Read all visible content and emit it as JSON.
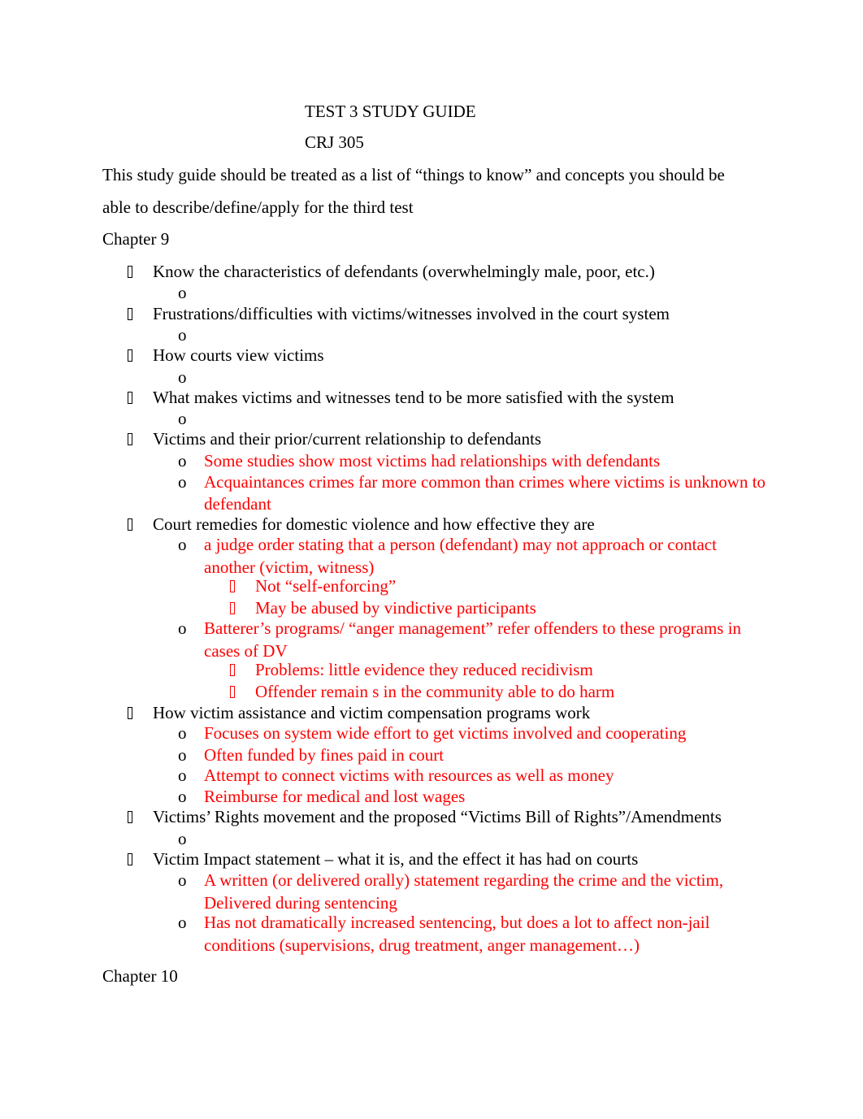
{
  "document": {
    "title": "TEST 3 STUDY GUIDE",
    "course": "CRJ 305",
    "intro_line1": "This study guide should be treated as a list of “things to know” and concepts you should be",
    "intro_line2": "able to describe/define/apply for the third test",
    "chapter9": "Chapter 9",
    "chapter10": "Chapter 10",
    "bullet_l2": "o",
    "items": [
      {
        "text": "Know the characteristics of defendants (overwhelmingly male, poor, etc.)"
      },
      {
        "text": "Frustrations/difficulties with victims/witnesses involved in the court system"
      },
      {
        "text": "How courts view victims"
      },
      {
        "text": "What makes victims and witnesses tend to be more satisfied with the system"
      },
      {
        "text": "Victims and their prior/current relationship to defendants",
        "subs": [
          "Some studies show most victims had relationships with defendants",
          "Acquaintances crimes far more common than crimes where victims is unknown to",
          "defendant"
        ]
      },
      {
        "text": "Court remedies for domestic violence and how effective they are",
        "subs": [
          "a judge order stating that a person (defendant) may not approach or contact",
          "another (victim, witness)",
          "Not “self-enforcing”",
          "May be abused by vindictive participants",
          "Batterer’s programs/ “anger management” refer offenders to these programs in",
          "cases of DV",
          "Problems: little evidence they reduced recidivism",
          "Offender remain s in the community able to do harm"
        ]
      },
      {
        "text": "How victim assistance and victim compensation programs work",
        "subs": [
          "Focuses on system wide effort to get victims involved and cooperating",
          "Often funded by fines paid in court",
          "Attempt to connect victims with resources as well as money",
          "Reimburse for medical and lost wages"
        ]
      },
      {
        "text": "Victims’ Rights movement and the proposed “Victims Bill of Rights”/Amendments"
      },
      {
        "text": "Victim Impact statement – what it is, and the effect it has had on courts",
        "subs": [
          "A written (or delivered orally) statement regarding the crime and the victim,",
          "Delivered during sentencing",
          "Has not dramatically increased sentencing, but does a lot to affect non-jail",
          "conditions (supervisions, drug treatment, anger management…)"
        ]
      }
    ],
    "colors": {
      "text": "#000000",
      "answer": "#ff0000"
    }
  }
}
